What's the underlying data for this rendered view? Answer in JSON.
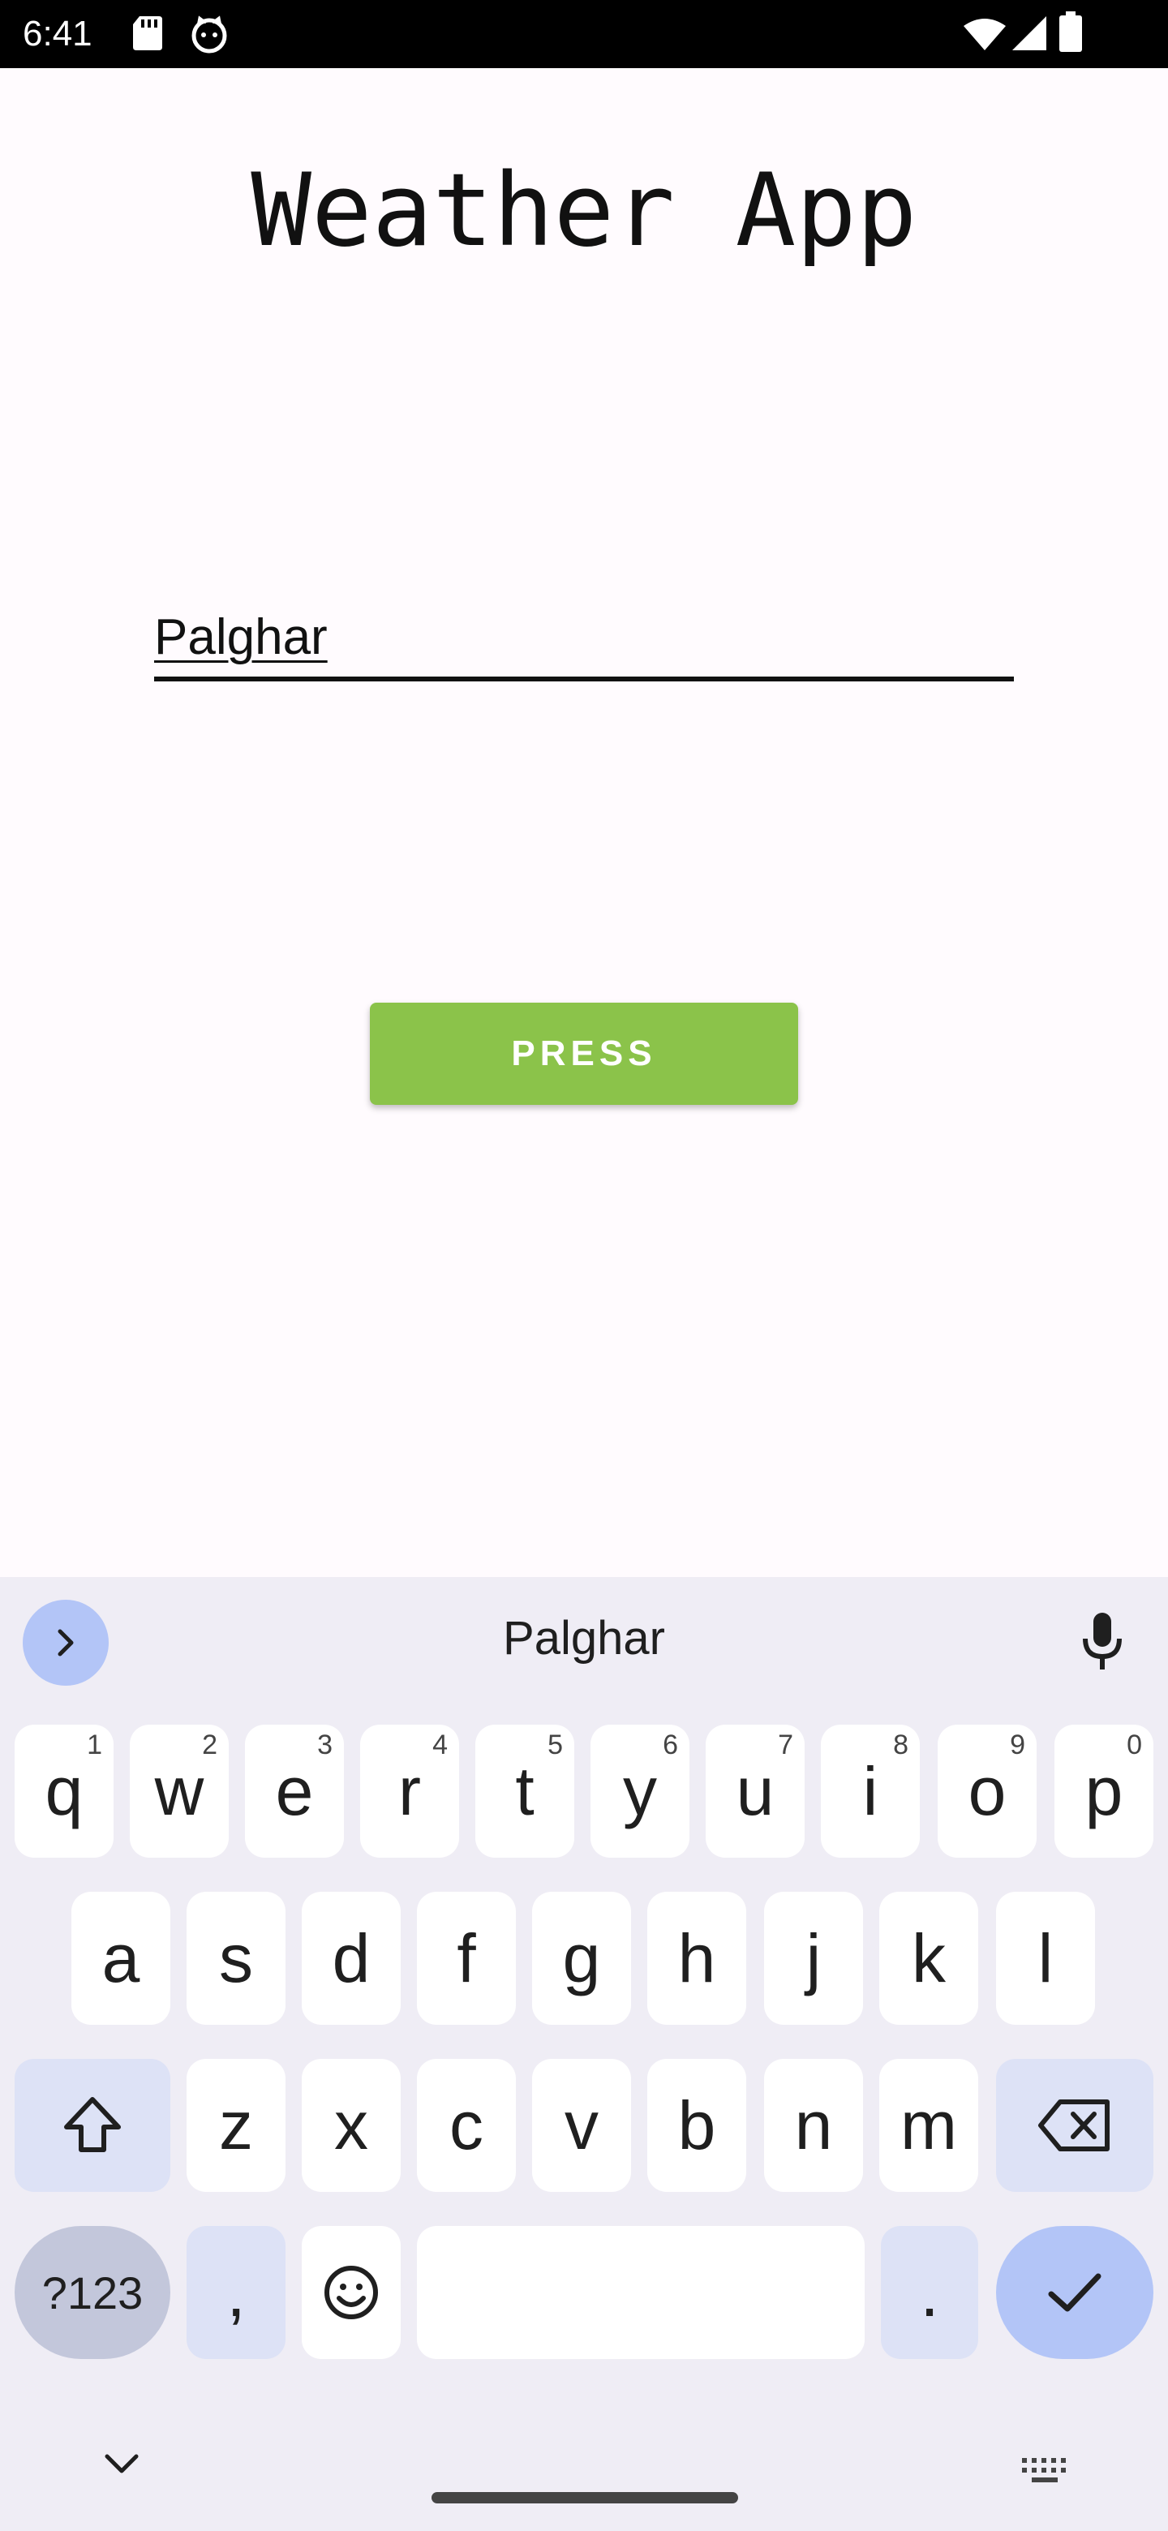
{
  "status_bar": {
    "time": "6:41",
    "icons": [
      "sd-card-icon",
      "cat-icon",
      "wifi-icon",
      "signal-icon",
      "battery-icon"
    ]
  },
  "app": {
    "title": "Weather App",
    "city_input": {
      "value": "Palghar",
      "placeholder": ""
    },
    "press_button_label": "PRESS"
  },
  "keyboard": {
    "suggestion": "Palghar",
    "row1": [
      {
        "key": "q",
        "hint": "1"
      },
      {
        "key": "w",
        "hint": "2"
      },
      {
        "key": "e",
        "hint": "3"
      },
      {
        "key": "r",
        "hint": "4"
      },
      {
        "key": "t",
        "hint": "5"
      },
      {
        "key": "y",
        "hint": "6"
      },
      {
        "key": "u",
        "hint": "7"
      },
      {
        "key": "i",
        "hint": "8"
      },
      {
        "key": "o",
        "hint": "9"
      },
      {
        "key": "p",
        "hint": "0"
      }
    ],
    "row2": [
      "a",
      "s",
      "d",
      "f",
      "g",
      "h",
      "j",
      "k",
      "l"
    ],
    "row3": [
      "z",
      "x",
      "c",
      "v",
      "b",
      "n",
      "m"
    ],
    "symbols_label": "?123",
    "comma": ",",
    "period": "."
  },
  "colors": {
    "button": "#8bc34a",
    "keyboard_bg": "#efedf5",
    "accent_key": "#b3c5f7"
  }
}
